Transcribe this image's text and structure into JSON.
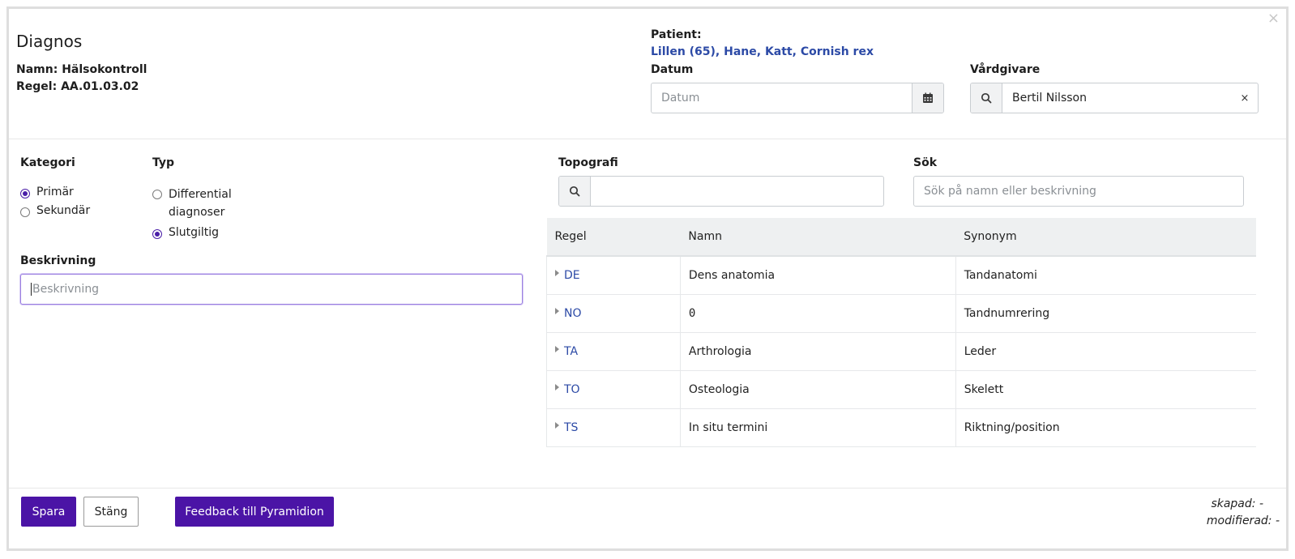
{
  "dialog": {
    "title": "Diagnos",
    "close_glyph": "×",
    "namn_line": "Namn: Hälsokontroll",
    "regel_line": "Regel: AA.01.03.02"
  },
  "patient": {
    "label": "Patient:",
    "value": "Lillen (65), Hane, Katt, Cornish rex"
  },
  "datum": {
    "label": "Datum",
    "placeholder": "Datum",
    "icon": "calendar-icon"
  },
  "vardgivare": {
    "label": "Vårdgivare",
    "value": "Bertil Nilsson",
    "clear_glyph": "×",
    "icon": "search-icon"
  },
  "kategori": {
    "label": "Kategori",
    "options": [
      {
        "label": "Primär",
        "checked": true
      },
      {
        "label": "Sekundär",
        "checked": false
      }
    ]
  },
  "typ": {
    "label": "Typ",
    "options": [
      {
        "label_line1": "Differential",
        "label_line2": "diagnoser",
        "checked": false
      },
      {
        "label_line1": "Slutgiltig",
        "label_line2": "",
        "checked": true
      }
    ]
  },
  "beskrivning": {
    "label": "Beskrivning",
    "placeholder": "Beskrivning"
  },
  "topografi": {
    "label": "Topografi",
    "value": ""
  },
  "sok": {
    "label": "Sök",
    "placeholder": "Sök på namn eller beskrivning"
  },
  "table": {
    "headers": [
      "Regel",
      "Namn",
      "Synonym"
    ],
    "rows": [
      {
        "regel": "DE",
        "namn": "Dens anatomia",
        "synonym": "Tandanatomi"
      },
      {
        "regel": "NO",
        "namn": "0",
        "synonym": "Tandnumrering"
      },
      {
        "regel": "TA",
        "namn": "Arthrologia",
        "synonym": "Leder"
      },
      {
        "regel": "TO",
        "namn": "Osteologia",
        "synonym": "Skelett"
      },
      {
        "regel": "TS",
        "namn": "In situ termini",
        "synonym": "Riktning/position"
      }
    ]
  },
  "footer": {
    "save_label": "Spara",
    "close_label": "Stäng",
    "feedback_label": "Feedback till Pyramidion",
    "skapad": "skapad: -",
    "modifierad": "modifierad: -"
  },
  "colors": {
    "primary": "#4b14a6",
    "link": "#2c4aa6"
  }
}
